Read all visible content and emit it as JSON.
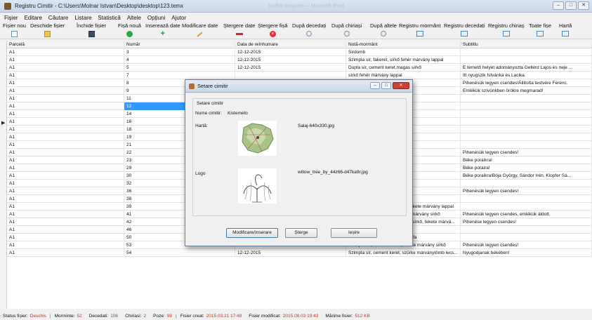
{
  "window": {
    "title": "Registru Cimitir - C:\\Users\\Molnar Istvan\\Desktop\\desktop\\123.temx",
    "ghost": "Toolbar program — Microsoft Word"
  },
  "menu": [
    "Fișier",
    "Editare",
    "Căutare",
    "Listare",
    "Statistică",
    "Altele",
    "Opțiuni",
    "Ajutor"
  ],
  "toolbar": [
    {
      "label": "Fișier nou",
      "icon": "new-file-icon"
    },
    {
      "label": "Deschide fișier",
      "icon": "open-folder-icon"
    },
    {
      "label": "Închide fișier",
      "icon": "save-icon"
    },
    {
      "label": "Fișă nouă",
      "icon": "add-circle-icon"
    },
    {
      "label": "Inserează date",
      "icon": "plus-icon"
    },
    {
      "label": "Modificare date",
      "icon": "pencil-icon"
    },
    {
      "label": "Ștergere date",
      "icon": "minus-icon"
    },
    {
      "label": "Ștergere fișă",
      "icon": "delete-circle-icon"
    },
    {
      "label": "După decedați",
      "icon": "search-icon"
    },
    {
      "label": "După chiriași",
      "icon": "search-icon"
    },
    {
      "label": "După altele",
      "icon": "search-icon"
    },
    {
      "label": "Registru mormânt",
      "icon": "register-icon"
    },
    {
      "label": "Registru decedați",
      "icon": "register-icon"
    },
    {
      "label": "Registru chiriaș",
      "icon": "register-icon"
    },
    {
      "label": "Toate fișe",
      "icon": "register-icon"
    },
    {
      "label": "Hartă",
      "icon": "map-icon"
    }
  ],
  "grid": {
    "columns": [
      "Parcelă",
      "Număr",
      "Data de reînhumare",
      "Notă-mormânt",
      "Subtitlu"
    ],
    "rows": [
      [
        "A1",
        "3",
        "12-12-2015",
        "Sirdomb",
        ""
      ],
      [
        "A1",
        "4",
        "12-12-2015",
        "Szimpla sír, fakeret, sírkő fehér márvány lappal",
        ""
      ],
      [
        "A1",
        "5",
        "12-12-2015",
        "Dupla sír, cement keret,magas sírkő",
        "E temető helyet adományozta Gellérd Lajos és neje ..."
      ],
      [
        "A1",
        "7",
        "",
        "sírkő fehér márvány lappal",
        "Itt nyugszik Istvánka és Lacika."
      ],
      [
        "A1",
        "8",
        "",
        "el sírkő, mindkettő fekete...",
        "Pihenésük legyen csendes!Állította testvére Ferenc."
      ],
      [
        "A1",
        "9",
        "",
        "sírkő fehér márványból,ké...",
        "Emlékük szívünkben örökre megmarad!"
      ],
      [
        "A1",
        "11",
        "",
        "et kopjafa",
        ""
      ],
      [
        "A1",
        "12",
        "",
        "et kopjafa",
        ""
      ],
      [
        "A1",
        "14",
        "",
        "hér lappal",
        ""
      ],
      [
        "A1",
        "16",
        "",
        "kete márvány lappal",
        ""
      ],
      [
        "A1",
        "18",
        "",
        "fehér sírkő",
        ""
      ],
      [
        "A1",
        "19",
        "",
        "fekete márvány sírkő",
        ""
      ],
      [
        "A1",
        "21",
        "",
        "sírkő fehér márvány lappal",
        ""
      ],
      [
        "A1",
        "22",
        "",
        "sírkő fekete márvány lappal",
        "Pihenésük legyen csendes!"
      ],
      [
        "A1",
        "23",
        "",
        "hér márvány lappal, fény...",
        "Béke poraikra!"
      ],
      [
        "A1",
        "29",
        "",
        "kopjafa",
        "Béke poraira!"
      ],
      [
        "A1",
        "30",
        "",
        "sírkő fehér márvány lappal",
        "Béke poraikra!Bója György, Sándor Irén, Klopfer Sá..."
      ],
      [
        "A1",
        "32",
        "",
        "sírkő fekete márvány lap...",
        ""
      ],
      [
        "A1",
        "36",
        "",
        "sírkő fekete márvány lappal",
        "Pihenésük legyen csendes!"
      ],
      [
        "A1",
        "38",
        "",
        "kopjafa",
        ""
      ],
      [
        "A1",
        "39",
        "12-12-2015",
        "Dupla sír, cement keret, sírkő fekete márvány lappal",
        ""
      ],
      [
        "A1",
        "41",
        "12-12-2015",
        "Dupla sír, cement keret, fekete márvány sírkő",
        "Pihenésük legyen csendes, emlékük áldott."
      ],
      [
        "A1",
        "42",
        "12-12-2015",
        "Szimpla sír, cement keret, kicsi sírkő, fekete márvá...",
        "Pihenése legyen csendes!"
      ],
      [
        "A1",
        "46",
        "12-12-2015",
        "Szimpla sír, fakeret, sírkő darab",
        ""
      ],
      [
        "A1",
        "50",
        "12-12-2015",
        "Szimpla sír, cement keret, kopjafa",
        ""
      ],
      [
        "A1",
        "53",
        "12-12-2015",
        "Szimpla sír, cement fedett, fekete márvány sírkő",
        "Pihenésük legyen csendes!"
      ],
      [
        "A1",
        "54",
        "12-12-2015",
        "Szimpla sír, cement keret, szürke márványtömb lecs...",
        "Nyugodjanak békében!"
      ]
    ],
    "selected_index": 7
  },
  "dialog": {
    "title": "Setare cimitir",
    "group_caption": "Setare cimitir",
    "name_label": "Nume cimitir:",
    "name_value": "Kistemeto",
    "map_label": "Hartă:",
    "map_file": "Salaj-640x330.jpg",
    "logo_label": "Logo",
    "logo_file": "willow_tree_by_44z66-d47ka9r.jpg",
    "btn_modify": "Modificare/Inserare",
    "btn_delete": "Șterge",
    "btn_exit": "Ieșire"
  },
  "status": {
    "file_status_label": "Status fișier:",
    "file_status_value": "Deschis",
    "graves_label": "Morminte:",
    "graves_value": "52",
    "deceased_label": "Decedati:",
    "deceased_value": "106",
    "tenants_label": "Chiriasi:",
    "tenants_value": "2",
    "photos_label": "Poze:",
    "photos_value": "98",
    "created_label": "Fisier creat:",
    "created_value": "2015.03.21 17:48",
    "modified_label": "Fisier modificat:",
    "modified_value": "2015.08.03 19:43",
    "size_label": "Mărime fisier:",
    "size_value": "512 KB"
  }
}
